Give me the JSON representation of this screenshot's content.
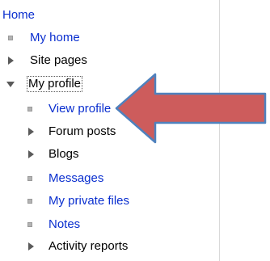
{
  "navigation": {
    "home_label": "Home",
    "items": [
      {
        "label": "My home",
        "type": "link",
        "marker": "bullet-icon"
      },
      {
        "label": "Site pages",
        "type": "branch",
        "marker": "expand-arrow-icon"
      },
      {
        "label": "My profile",
        "type": "branch-open",
        "marker": "collapse-arrow-icon"
      }
    ],
    "profile_children": [
      {
        "label": "View profile",
        "type": "link",
        "marker": "bullet-icon"
      },
      {
        "label": "Forum posts",
        "type": "branch",
        "marker": "expand-arrow-icon"
      },
      {
        "label": "Blogs",
        "type": "branch",
        "marker": "expand-arrow-icon"
      },
      {
        "label": "Messages",
        "type": "link",
        "marker": "bullet-icon"
      },
      {
        "label": "My private files",
        "type": "link",
        "marker": "bullet-icon"
      },
      {
        "label": "Notes",
        "type": "link",
        "marker": "bullet-icon"
      },
      {
        "label": "Activity reports",
        "type": "branch",
        "marker": "expand-arrow-icon"
      }
    ]
  },
  "colors": {
    "link": "#0a2fcf",
    "annotation_arrow_fill": "#cd5c5c",
    "annotation_arrow_stroke": "#4f81bd"
  }
}
